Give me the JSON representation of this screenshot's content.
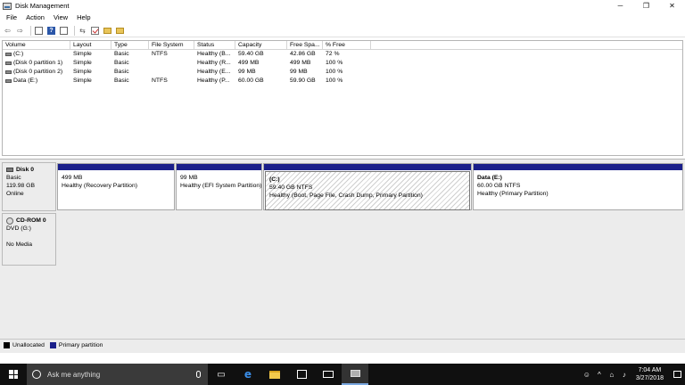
{
  "window": {
    "title": "Disk Management",
    "controls": [
      "─",
      "❐",
      "✕"
    ]
  },
  "menu": [
    "File",
    "Action",
    "View",
    "Help"
  ],
  "toolbar": {
    "icons": [
      "back-arrow-icon",
      "forward-arrow-icon",
      "console-tree-icon",
      "help-icon",
      "properties-icon",
      "refresh-icon",
      "check-icon",
      "open-icon",
      "explore-icon"
    ]
  },
  "volume_list": {
    "columns": [
      "Volume",
      "Layout",
      "Type",
      "File System",
      "Status",
      "Capacity",
      "Free Spa...",
      "% Free"
    ],
    "rows": [
      [
        "(C:)",
        "Simple",
        "Basic",
        "NTFS",
        "Healthy (B...",
        "59.40 GB",
        "42.86 GB",
        "72 %"
      ],
      [
        "(Disk 0 partition 1)",
        "Simple",
        "Basic",
        "",
        "Healthy (R...",
        "499 MB",
        "499 MB",
        "100 %"
      ],
      [
        "(Disk 0 partition 2)",
        "Simple",
        "Basic",
        "",
        "Healthy (E...",
        "99 MB",
        "99 MB",
        "100 %"
      ],
      [
        "Data (E:)",
        "Simple",
        "Basic",
        "NTFS",
        "Healthy (P...",
        "60.00 GB",
        "59.90 GB",
        "100 %"
      ]
    ]
  },
  "disks": [
    {
      "name": "Disk 0",
      "type": "Basic",
      "size": "119.98 GB",
      "status": "Online",
      "partitions": [
        {
          "title": "",
          "size": "499 MB",
          "status": "Healthy (Recovery Partition)"
        },
        {
          "title": "",
          "size": "99 MB",
          "status": "Healthy (EFI System Partition)"
        },
        {
          "title": "(C:)",
          "size": "59.40 GB NTFS",
          "status": "Healthy (Boot, Page File, Crash Dump, Primary Partition)"
        },
        {
          "title": "Data  (E:)",
          "size": "60.00 GB NTFS",
          "status": "Healthy (Primary Partition)"
        }
      ]
    },
    {
      "name": "CD-ROM 0",
      "type": "DVD (G:)",
      "status": "No Media"
    }
  ],
  "legend": [
    {
      "label": "Unallocated",
      "color": "#000000"
    },
    {
      "label": "Primary partition",
      "color": "#1a1f8a"
    }
  ],
  "taskbar": {
    "search_placeholder": "Ask me anything",
    "time": "7:04 AM",
    "date": "3/27/2018"
  }
}
